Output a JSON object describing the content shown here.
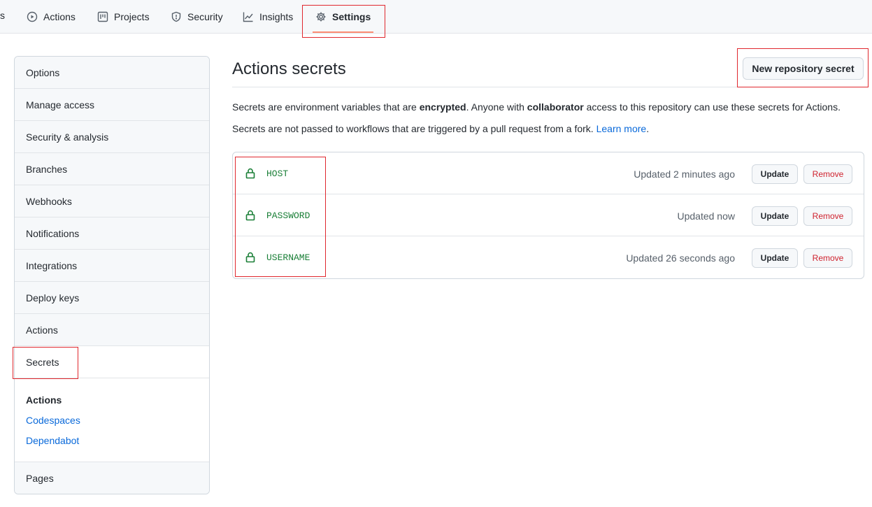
{
  "nav": {
    "cut_label": "s",
    "tabs": [
      {
        "label": "Actions",
        "icon": "play-circle-icon"
      },
      {
        "label": "Projects",
        "icon": "project-board-icon"
      },
      {
        "label": "Security",
        "icon": "shield-icon"
      },
      {
        "label": "Insights",
        "icon": "graph-icon"
      },
      {
        "label": "Settings",
        "icon": "gear-icon",
        "selected": true
      }
    ]
  },
  "sidebar": {
    "items": [
      "Options",
      "Manage access",
      "Security & analysis",
      "Branches",
      "Webhooks",
      "Notifications",
      "Integrations",
      "Deploy keys",
      "Actions",
      "Secrets"
    ],
    "active": "Secrets",
    "group": {
      "title": "Actions",
      "links": [
        "Codespaces",
        "Dependabot"
      ]
    },
    "footer_item": "Pages"
  },
  "main": {
    "title": "Actions secrets",
    "new_button": "New repository secret",
    "desc1": {
      "p1": "Secrets are environment variables that are ",
      "b1": "encrypted",
      "p2": ". Anyone with ",
      "b2": "collaborator",
      "p3": " access to this repository can use these secrets for Actions."
    },
    "desc2": {
      "text": "Secrets are not passed to workflows that are triggered by a pull request from a fork. ",
      "link": "Learn more",
      "after": "."
    },
    "secrets": [
      {
        "name": "HOST",
        "updated": "Updated 2 minutes ago",
        "update_label": "Update",
        "remove_label": "Remove"
      },
      {
        "name": "PASSWORD",
        "updated": "Updated now",
        "update_label": "Update",
        "remove_label": "Remove"
      },
      {
        "name": "USERNAME",
        "updated": "Updated 26 seconds ago",
        "update_label": "Update",
        "remove_label": "Remove"
      }
    ]
  },
  "colors": {
    "accent_link": "#0969da",
    "secret_green": "#1a7f37",
    "danger": "#cf222e",
    "highlight_box": "#e0282e",
    "selected_underline": "#fd8c73"
  }
}
